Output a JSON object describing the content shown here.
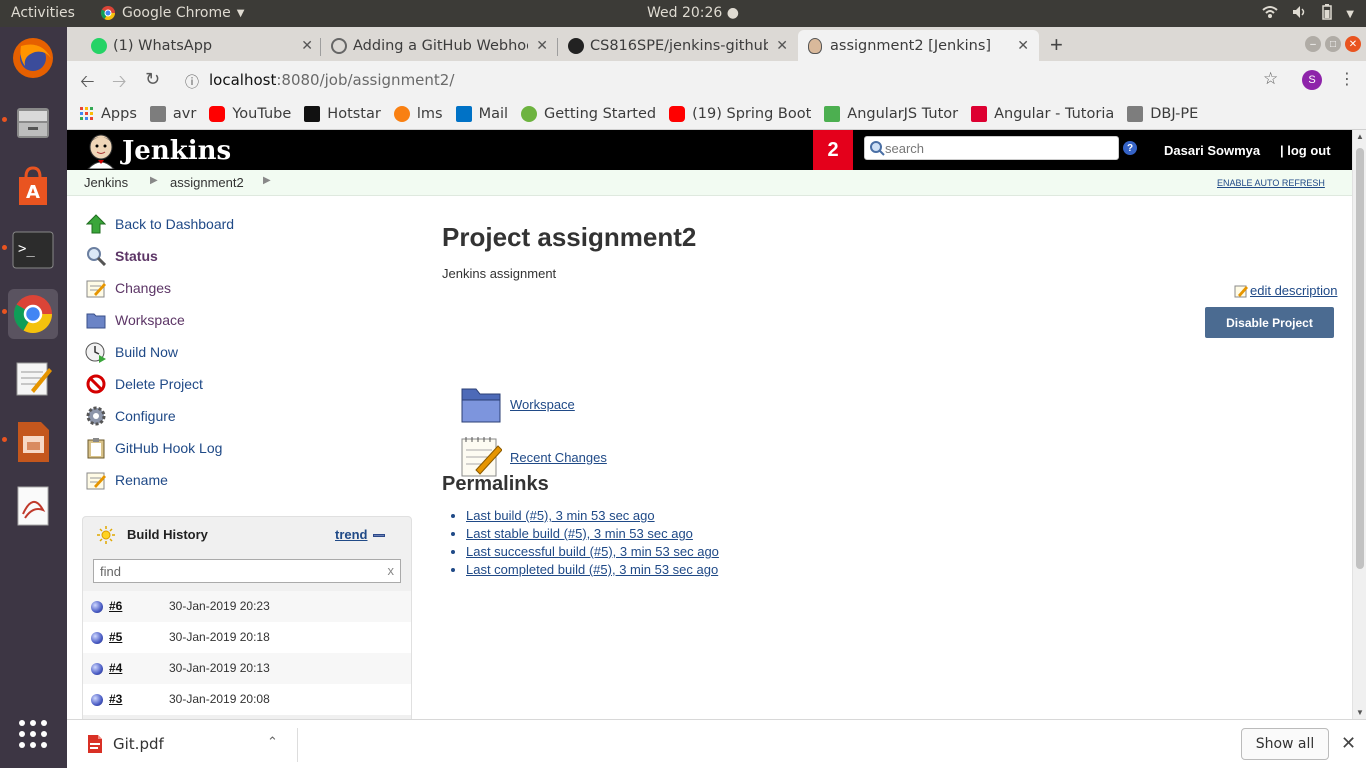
{
  "os": {
    "activities": "Activities",
    "app_name": "Google Chrome",
    "clock": "Wed 20:26 ●"
  },
  "tabs": [
    {
      "title": "(1) WhatsApp"
    },
    {
      "title": "Adding a GitHub Webhoo"
    },
    {
      "title": "CS816SPE/jenkins-github"
    },
    {
      "title": "assignment2 [Jenkins]"
    }
  ],
  "url": {
    "host": "localhost",
    "rest": ":8080/job/assignment2/"
  },
  "profile_initial": "S",
  "bookmarks": [
    "Apps",
    "avr",
    "YouTube",
    "Hotstar",
    "lms",
    "Mail",
    "Getting Started",
    "(19) Spring Boot",
    "AngularJS Tutor",
    "Angular - Tutoria",
    "DBJ-PE"
  ],
  "jenkins": {
    "logo": "Jenkins",
    "badge": "2",
    "search_placeholder": "search",
    "help": "?",
    "user": "Dasari Sowmya",
    "logout": "| log out",
    "breadcrumb": [
      "Jenkins",
      "assignment2"
    ],
    "auto_refresh": "ENABLE AUTO REFRESH"
  },
  "sidebar": [
    {
      "label": "Back to Dashboard"
    },
    {
      "label": "Status"
    },
    {
      "label": "Changes"
    },
    {
      "label": "Workspace"
    },
    {
      "label": "Build Now"
    },
    {
      "label": "Delete Project"
    },
    {
      "label": "Configure"
    },
    {
      "label": "GitHub Hook Log"
    },
    {
      "label": "Rename"
    }
  ],
  "build_history": {
    "title": "Build History",
    "trend": "trend",
    "find_placeholder": "find",
    "clear": "x",
    "builds": [
      {
        "num": "#6",
        "date": "30-Jan-2019 20:23"
      },
      {
        "num": "#5",
        "date": "30-Jan-2019 20:18"
      },
      {
        "num": "#4",
        "date": "30-Jan-2019 20:13"
      },
      {
        "num": "#3",
        "date": "30-Jan-2019 20:08"
      }
    ]
  },
  "main": {
    "title": "Project assignment2",
    "description": "Jenkins assignment",
    "edit_description": "edit description",
    "disable_button": "Disable Project",
    "workspace": "Workspace",
    "recent_changes": "Recent Changes",
    "permalinks_title": "Permalinks",
    "permalinks": [
      "Last build (#5), 3 min 53 sec ago",
      "Last stable build (#5), 3 min 53 sec ago",
      "Last successful build (#5), 3 min 53 sec ago",
      "Last completed build (#5), 3 min 53 sec ago"
    ]
  },
  "downloads": {
    "file": "Git.pdf",
    "show_all": "Show all"
  }
}
